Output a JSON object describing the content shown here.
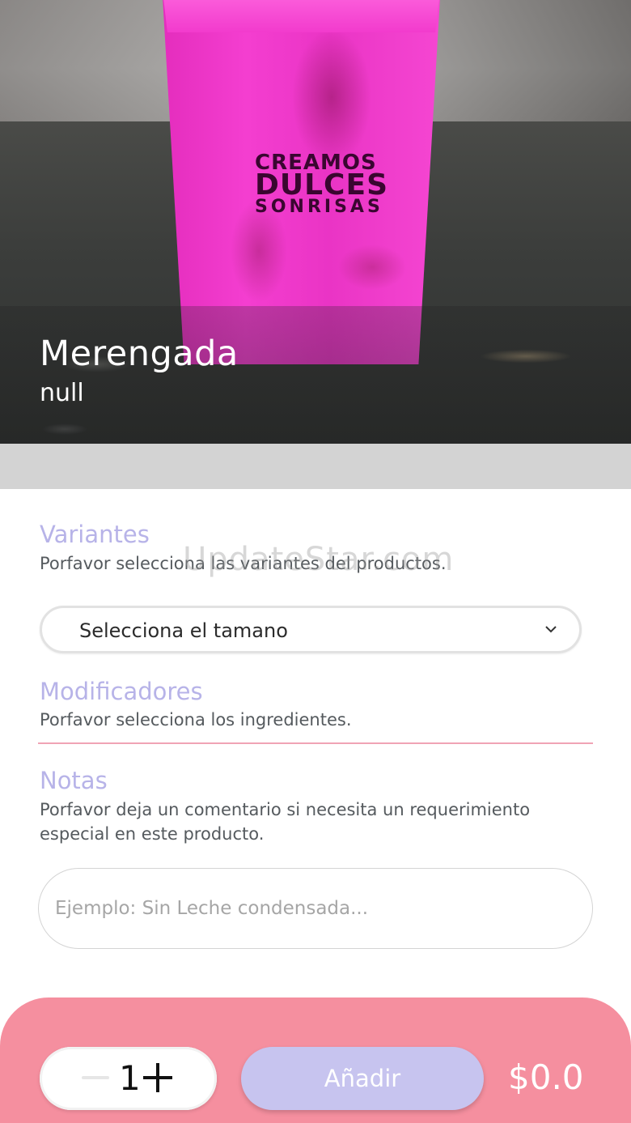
{
  "product": {
    "title": "Merengada",
    "subtitle": "null",
    "image_print": {
      "line1": "CREAMOS",
      "line2": "DULCES",
      "line3": "SONRISAS"
    }
  },
  "variants": {
    "heading": "Variantes",
    "description": "Porfavor selecciona las variantes del productos.",
    "select_value": "Selecciona el tamano",
    "chevron_icon": "chevron-down-icon"
  },
  "modifiers": {
    "heading": "Modificadores",
    "description": "Porfavor selecciona los ingredientes."
  },
  "notes": {
    "heading": "Notas",
    "description": "Porfavor deja un comentario si necesita un requerimiento especial en este producto.",
    "placeholder": "Ejemplo: Sin Leche condensada...",
    "value": ""
  },
  "watermark": "UpdateStar.com",
  "footer": {
    "quantity": "1",
    "minus_icon": "minus-icon",
    "plus_icon": "plus-icon",
    "add_label": "Añadir",
    "price": "$0.0"
  },
  "colors": {
    "accent_lavender": "#c7c4ef",
    "heading_lavender": "#b7b3e8",
    "footer_pink": "#f58f9f",
    "divider_pink": "#f0a4b5"
  }
}
